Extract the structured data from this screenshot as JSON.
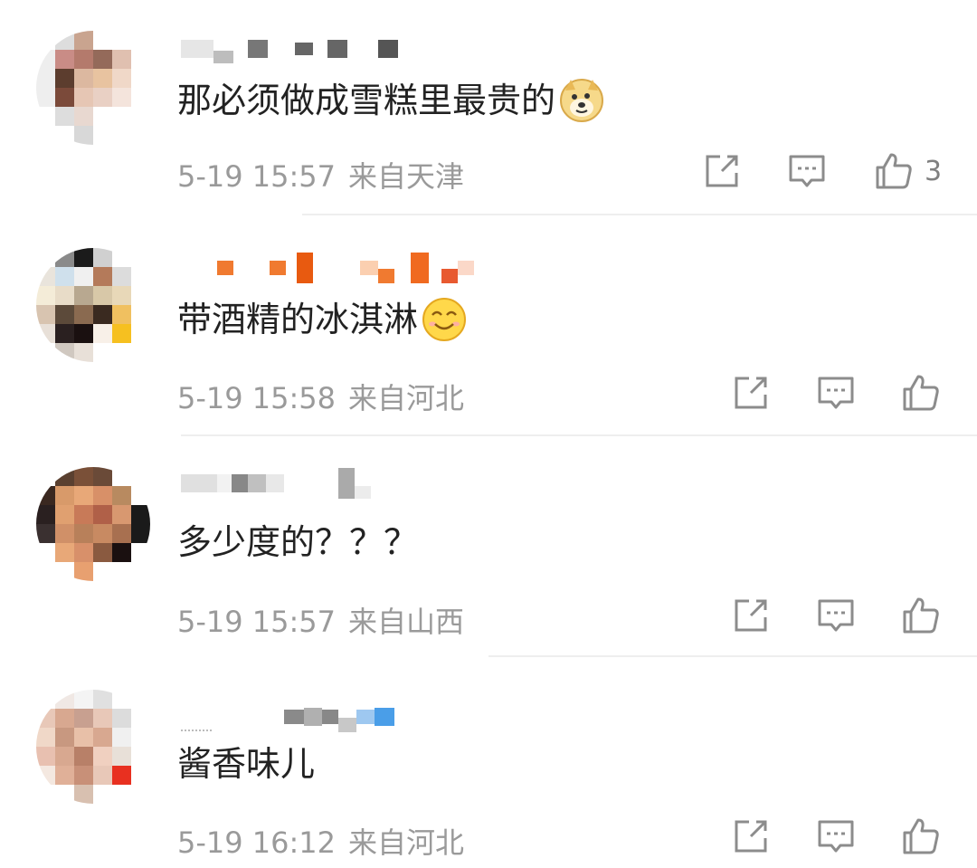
{
  "comments": [
    {
      "text": "那必须做成雪糕里最贵的",
      "date": "5-19 15:57",
      "location": "来自天津",
      "like_count": "3",
      "emoji": "doge-emoji"
    },
    {
      "text": "带酒精的冰淇淋",
      "date": "5-19 15:58",
      "location": "来自河北",
      "like_count": "",
      "emoji": "smile-emoji"
    },
    {
      "text": "多少度的？？？",
      "date": "5-19 15:57",
      "location": "来自山西",
      "like_count": ""
    },
    {
      "text": "酱香味儿",
      "date": "5-19 16:12",
      "location": "来自河北",
      "like_count": ""
    }
  ],
  "icons": {
    "share": "share-icon",
    "reply": "comment-icon",
    "like": "thumbs-up-icon"
  },
  "colors": {
    "text": "#222222",
    "meta": "#9a9a9a",
    "icon": "#8c8c8c",
    "divider": "#eeeeee"
  }
}
